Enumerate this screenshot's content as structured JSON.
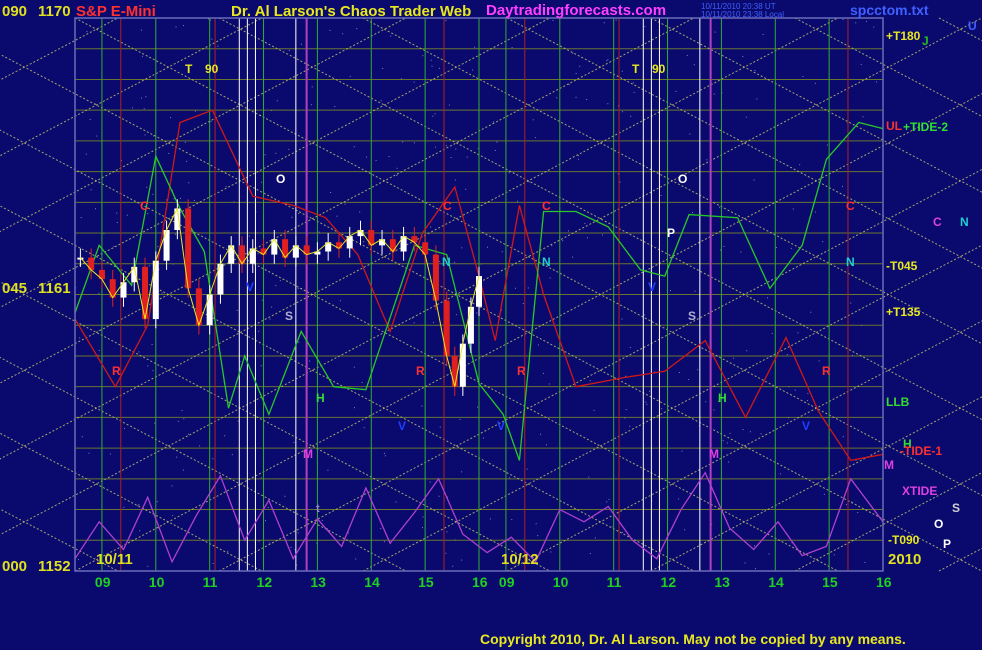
{
  "header": {
    "left_axis_top": "090",
    "price_top": "1170",
    "symbol": "S&P E-Mini",
    "title": "Dr. Al Larson's Chaos Trader Web",
    "site": "Daytradingforecasts.com",
    "timestamp_1": "10/11/2010 20:38 UT",
    "timestamp_2": "10/11/2010 23:38 Local",
    "file": "spcctom.txt",
    "corner": "U"
  },
  "footer": {
    "copyright": "Copyright 2010, Dr. Al Larson.  May not be copied by any means."
  },
  "colors": {
    "background": "#0a0a6e",
    "plot_border": "#6a6ab8",
    "vgrid_green": "#2fae2f",
    "vgrid_red": "#b02020",
    "vgrid_magenta": "#b040c0",
    "vgrid_white": "#ffffff",
    "hgrid": "#7f8f20",
    "diag": "#d8d870",
    "price": "#ffffff",
    "price_down": "#e02020",
    "tide_green": "#28c828",
    "tide_red": "#d01818",
    "xtide": "#b040d0",
    "axis_label": "#e0e020",
    "hour_label": "#20d020"
  },
  "chart_data": {
    "type": "line",
    "title": "Dr. Al Larson's Chaos Trader Web",
    "subtitle": "S&P E-Mini",
    "ylim": [
      1152,
      1170
    ],
    "y_ticks": [
      {
        "angle": "090",
        "price": "1170",
        "value": 1170
      },
      {
        "angle": "045",
        "price": "1161",
        "value": 1161
      },
      {
        "angle": "000",
        "price": "1152",
        "value": 1152
      }
    ],
    "x_days": [
      {
        "label": "10/11",
        "start_hour": 8.5
      },
      {
        "label": "10/12",
        "start_hour": 8.5
      }
    ],
    "x_hour_labels": [
      "09",
      "10",
      "11",
      "12",
      "13",
      "14",
      "15",
      "16",
      "09",
      "10",
      "11",
      "12",
      "13",
      "14",
      "15",
      "16"
    ],
    "year_label": "2010",
    "right_labels": [
      "+T180",
      "J",
      "UL",
      "+TIDE-2",
      "C",
      "N",
      "-T045",
      "+T135",
      "LLB",
      "H",
      "-TIDE-1",
      "M",
      "XTIDE",
      "S",
      "O",
      "-T090",
      "P"
    ],
    "in_plot_letters": [
      "T",
      "90",
      "O",
      "C",
      "S",
      "R",
      "H",
      "M",
      "N",
      "V",
      "P",
      "t"
    ],
    "price_series": [
      {
        "h": 8.6,
        "v": 1162.2
      },
      {
        "h": 8.8,
        "v": 1161.8
      },
      {
        "h": 9.0,
        "v": 1161.5
      },
      {
        "h": 9.2,
        "v": 1160.9
      },
      {
        "h": 9.4,
        "v": 1161.4
      },
      {
        "h": 9.6,
        "v": 1161.9
      },
      {
        "h": 9.8,
        "v": 1160.2
      },
      {
        "h": 10.0,
        "v": 1162.1
      },
      {
        "h": 10.2,
        "v": 1163.1
      },
      {
        "h": 10.4,
        "v": 1163.8
      },
      {
        "h": 10.6,
        "v": 1161.2
      },
      {
        "h": 10.8,
        "v": 1160.0
      },
      {
        "h": 11.0,
        "v": 1161.0
      },
      {
        "h": 11.2,
        "v": 1162.0
      },
      {
        "h": 11.4,
        "v": 1162.6
      },
      {
        "h": 11.6,
        "v": 1162.0
      },
      {
        "h": 11.8,
        "v": 1162.5
      },
      {
        "h": 12.0,
        "v": 1162.3
      },
      {
        "h": 12.2,
        "v": 1162.8
      },
      {
        "h": 12.4,
        "v": 1162.2
      },
      {
        "h": 12.6,
        "v": 1162.6
      },
      {
        "h": 12.8,
        "v": 1162.3
      },
      {
        "h": 13.0,
        "v": 1162.4
      },
      {
        "h": 13.2,
        "v": 1162.7
      },
      {
        "h": 13.4,
        "v": 1162.5
      },
      {
        "h": 13.6,
        "v": 1162.9
      },
      {
        "h": 13.8,
        "v": 1163.1
      },
      {
        "h": 14.0,
        "v": 1162.6
      },
      {
        "h": 14.2,
        "v": 1162.8
      },
      {
        "h": 14.4,
        "v": 1162.4
      },
      {
        "h": 14.6,
        "v": 1162.9
      },
      {
        "h": 14.8,
        "v": 1162.7
      },
      {
        "h": 15.0,
        "v": 1162.3
      },
      {
        "h": 15.2,
        "v": 1160.8
      },
      {
        "h": 15.4,
        "v": 1159.0
      },
      {
        "h": 15.55,
        "v": 1158.0
      },
      {
        "h": 15.7,
        "v": 1159.4
      },
      {
        "h": 15.85,
        "v": 1160.6
      },
      {
        "h": 16.0,
        "v": 1161.6
      }
    ],
    "tide_green": [
      {
        "x": 0.0,
        "v": 1160.4
      },
      {
        "x": 0.03,
        "v": 1162.6
      },
      {
        "x": 0.07,
        "v": 1161.3
      },
      {
        "x": 0.1,
        "v": 1165.5
      },
      {
        "x": 0.13,
        "v": 1163.8
      },
      {
        "x": 0.16,
        "v": 1162.4
      },
      {
        "x": 0.19,
        "v": 1157.3
      },
      {
        "x": 0.21,
        "v": 1159.0
      },
      {
        "x": 0.24,
        "v": 1157.1
      },
      {
        "x": 0.28,
        "v": 1159.8
      },
      {
        "x": 0.32,
        "v": 1158.0
      },
      {
        "x": 0.36,
        "v": 1157.9
      },
      {
        "x": 0.42,
        "v": 1162.6
      },
      {
        "x": 0.46,
        "v": 1162.3
      },
      {
        "x": 0.5,
        "v": 1158.1
      },
      {
        "x": 0.53,
        "v": 1157.1
      },
      {
        "x": 0.55,
        "v": 1155.6
      },
      {
        "x": 0.58,
        "v": 1163.7
      },
      {
        "x": 0.62,
        "v": 1163.7
      },
      {
        "x": 0.66,
        "v": 1163.2
      },
      {
        "x": 0.7,
        "v": 1161.8
      },
      {
        "x": 0.73,
        "v": 1161.6
      },
      {
        "x": 0.76,
        "v": 1163.6
      },
      {
        "x": 0.82,
        "v": 1163.5
      },
      {
        "x": 0.86,
        "v": 1161.2
      },
      {
        "x": 0.9,
        "v": 1162.6
      },
      {
        "x": 0.93,
        "v": 1165.4
      },
      {
        "x": 0.97,
        "v": 1166.6
      },
      {
        "x": 1.0,
        "v": 1166.4
      }
    ],
    "tide_red": [
      {
        "x": 0.0,
        "v": 1160.2
      },
      {
        "x": 0.05,
        "v": 1158.0
      },
      {
        "x": 0.09,
        "v": 1160.0
      },
      {
        "x": 0.13,
        "v": 1166.6
      },
      {
        "x": 0.17,
        "v": 1167.0
      },
      {
        "x": 0.22,
        "v": 1164.2
      },
      {
        "x": 0.27,
        "v": 1163.9
      },
      {
        "x": 0.31,
        "v": 1163.5
      },
      {
        "x": 0.35,
        "v": 1162.3
      },
      {
        "x": 0.39,
        "v": 1159.8
      },
      {
        "x": 0.43,
        "v": 1163.0
      },
      {
        "x": 0.47,
        "v": 1164.5
      },
      {
        "x": 0.5,
        "v": 1161.6
      },
      {
        "x": 0.52,
        "v": 1159.5
      },
      {
        "x": 0.55,
        "v": 1163.9
      },
      {
        "x": 0.58,
        "v": 1161.0
      },
      {
        "x": 0.62,
        "v": 1158.0
      },
      {
        "x": 0.68,
        "v": 1158.3
      },
      {
        "x": 0.73,
        "v": 1158.5
      },
      {
        "x": 0.78,
        "v": 1159.5
      },
      {
        "x": 0.83,
        "v": 1157.0
      },
      {
        "x": 0.88,
        "v": 1159.6
      },
      {
        "x": 0.92,
        "v": 1157.2
      },
      {
        "x": 0.96,
        "v": 1155.6
      },
      {
        "x": 1.0,
        "v": 1155.8
      }
    ],
    "xtide": [
      {
        "x": 0.0,
        "v": 1152.4
      },
      {
        "x": 0.03,
        "v": 1153.6
      },
      {
        "x": 0.06,
        "v": 1152.7
      },
      {
        "x": 0.09,
        "v": 1154.4
      },
      {
        "x": 0.12,
        "v": 1152.3
      },
      {
        "x": 0.15,
        "v": 1153.8
      },
      {
        "x": 0.18,
        "v": 1155.1
      },
      {
        "x": 0.21,
        "v": 1153.0
      },
      {
        "x": 0.24,
        "v": 1154.3
      },
      {
        "x": 0.27,
        "v": 1152.4
      },
      {
        "x": 0.3,
        "v": 1153.7
      },
      {
        "x": 0.33,
        "v": 1152.8
      },
      {
        "x": 0.36,
        "v": 1154.7
      },
      {
        "x": 0.39,
        "v": 1152.9
      },
      {
        "x": 0.42,
        "v": 1153.9
      },
      {
        "x": 0.45,
        "v": 1155.0
      },
      {
        "x": 0.48,
        "v": 1153.2
      },
      {
        "x": 0.51,
        "v": 1152.6
      },
      {
        "x": 0.54,
        "v": 1153.1
      },
      {
        "x": 0.57,
        "v": 1152.3
      },
      {
        "x": 0.6,
        "v": 1154.0
      },
      {
        "x": 0.63,
        "v": 1153.6
      },
      {
        "x": 0.66,
        "v": 1154.1
      },
      {
        "x": 0.69,
        "v": 1153.0
      },
      {
        "x": 0.72,
        "v": 1152.4
      },
      {
        "x": 0.75,
        "v": 1154.0
      },
      {
        "x": 0.78,
        "v": 1155.2
      },
      {
        "x": 0.81,
        "v": 1153.4
      },
      {
        "x": 0.84,
        "v": 1152.7
      },
      {
        "x": 0.87,
        "v": 1153.6
      },
      {
        "x": 0.9,
        "v": 1152.5
      },
      {
        "x": 0.93,
        "v": 1152.8
      },
      {
        "x": 0.96,
        "v": 1155.0
      },
      {
        "x": 1.0,
        "v": 1153.6
      }
    ]
  }
}
